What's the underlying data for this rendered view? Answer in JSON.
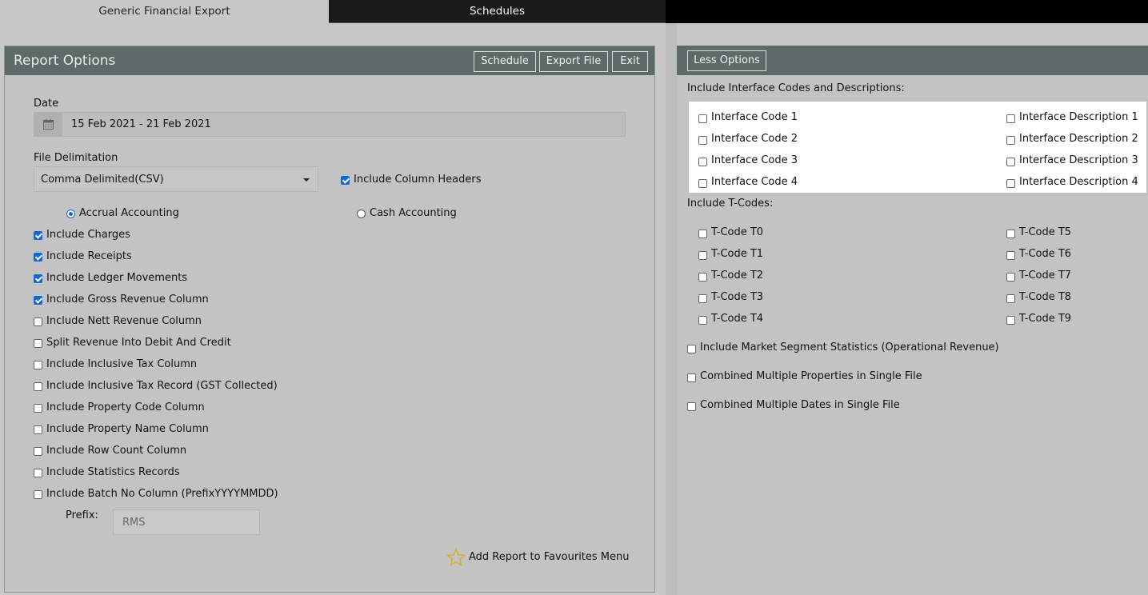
{
  "tabs": [
    {
      "label": "Generic Financial Export"
    },
    {
      "label": "Schedules"
    }
  ],
  "left_panel": {
    "title": "Report Options",
    "buttons": {
      "schedule": "Schedule",
      "export": "Export File",
      "exit": "Exit"
    },
    "date": {
      "label": "Date",
      "value": "15 Feb 2021 - 21 Feb 2021"
    },
    "file_delimitation": {
      "label": "File Delimitation",
      "selected": "Comma Delimited(CSV)"
    },
    "include_column_headers": {
      "label": "Include Column Headers",
      "checked": true
    },
    "accounting": {
      "accrual": "Accrual Accounting",
      "cash": "Cash Accounting",
      "selected": "accrual"
    },
    "options": [
      {
        "label": "Include Charges",
        "checked": true
      },
      {
        "label": "Include Receipts",
        "checked": true
      },
      {
        "label": "Include Ledger Movements",
        "checked": true
      },
      {
        "label": "Include Gross Revenue Column",
        "checked": true
      },
      {
        "label": "Include Nett Revenue Column",
        "checked": false
      },
      {
        "label": "Split Revenue Into Debit And Credit",
        "checked": false
      },
      {
        "label": "Include Inclusive Tax Column",
        "checked": false
      },
      {
        "label": "Include Inclusive Tax Record (GST Collected)",
        "checked": false
      },
      {
        "label": "Include Property Code Column",
        "checked": false
      },
      {
        "label": "Include Property Name Column",
        "checked": false
      },
      {
        "label": "Include Row Count Column",
        "checked": false
      },
      {
        "label": "Include Statistics Records",
        "checked": false
      },
      {
        "label": "Include Batch No Column (PrefixYYYYMMDD)",
        "checked": false
      }
    ],
    "prefix": {
      "label": "Prefix:",
      "value": "RMS"
    },
    "favourites": "Add Report to Favourites Menu"
  },
  "right_panel": {
    "less_options": "Less Options",
    "interface_heading": "Include Interface Codes and Descriptions:",
    "interface_codes": [
      "Interface Code 1",
      "Interface Code 2",
      "Interface Code 3",
      "Interface Code 4"
    ],
    "interface_descriptions": [
      "Interface Description 1",
      "Interface Description 2",
      "Interface Description 3",
      "Interface Description 4"
    ],
    "tcodes_heading": "Include T-Codes:",
    "tcodes_left": [
      "T-Code T0",
      "T-Code T1",
      "T-Code T2",
      "T-Code T3",
      "T-Code T4"
    ],
    "tcodes_right": [
      "T-Code T5",
      "T-Code T6",
      "T-Code T7",
      "T-Code T8",
      "T-Code T9"
    ],
    "extra_options": [
      "Include Market Segment Statistics (Operational Revenue)",
      "Combined Multiple Properties in Single File",
      "Combined Multiple Dates in Single File"
    ]
  }
}
